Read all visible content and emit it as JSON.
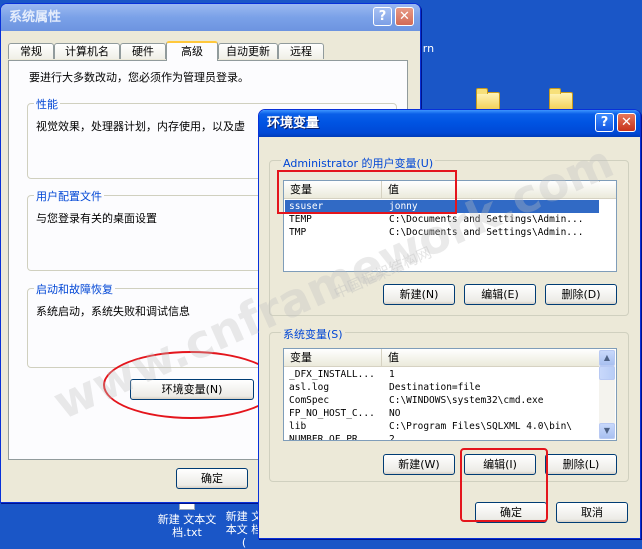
{
  "desktop": {
    "icon_labels": [
      "新建 文本文 档.txt",
      "新建 文本文 档 (",
      "arn"
    ]
  },
  "sysprops": {
    "title": "系统属性",
    "help_btn": "?",
    "close_btn": "✕",
    "tabs": [
      "常规",
      "计算机名",
      "硬件",
      "高级",
      "自动更新",
      "远程"
    ],
    "admin_note": "要进行大多数改动，您必须作为管理员登录。",
    "performance": {
      "title": "性能",
      "desc": "视觉效果，处理器计划，内存使用，以及虚"
    },
    "profile": {
      "title": "用户配置文件",
      "desc": "与您登录有关的桌面设置"
    },
    "startup": {
      "title": "启动和故障恢复",
      "desc": "系统启动，系统失败和调试信息"
    },
    "env_button": "环境变量(N)",
    "ok_button": "确定"
  },
  "envvars": {
    "title": "环境变量",
    "help_btn": "?",
    "close_btn": "✕",
    "user_group_title": "Administrator 的用户变量(U)",
    "columns": {
      "name": "变量",
      "value": "值"
    },
    "user_vars": [
      {
        "name": "ssuser",
        "value": "jonny"
      },
      {
        "name": "TEMP",
        "value": "C:\\Documents and Settings\\Admin..."
      },
      {
        "name": "TMP",
        "value": "C:\\Documents and Settings\\Admin..."
      }
    ],
    "user_buttons": {
      "new": "新建(N)",
      "edit": "编辑(E)",
      "delete": "删除(D)"
    },
    "system_group_title": "系统变量(S)",
    "system_vars": [
      {
        "name": "_DFX_INSTALL...",
        "value": "1"
      },
      {
        "name": "asl.log",
        "value": "Destination=file"
      },
      {
        "name": "ComSpec",
        "value": "C:\\WINDOWS\\system32\\cmd.exe"
      },
      {
        "name": "FP_NO_HOST_C...",
        "value": "NO"
      },
      {
        "name": "lib",
        "value": "C:\\Program Files\\SQLXML 4.0\\bin\\"
      },
      {
        "name": "NUMBER_OF_PR...",
        "value": "2"
      }
    ],
    "system_buttons": {
      "new": "新建(W)",
      "edit": "编辑(I)",
      "delete": "删除(L)"
    },
    "ok_button": "确定",
    "cancel_button": "取消"
  },
  "watermark": {
    "text": "www.cnframework.com",
    "sub": "中国框架结构网"
  },
  "colors": {
    "annotation_red": "#e4151c",
    "xp_blue": "#0054e3",
    "selection": "#316ac5"
  }
}
